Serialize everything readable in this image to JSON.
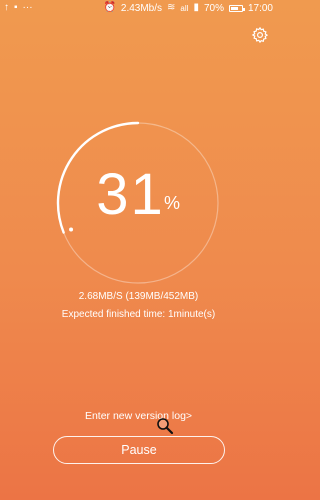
{
  "status_bar": {
    "speed": "2.43Mb/s",
    "signal": "all",
    "battery": "70%",
    "battery_level": 0.7,
    "time": "17:00",
    "left_icons": [
      "upload-icon",
      "image-icon",
      "more-dots-icon"
    ],
    "right_icons": [
      "alarm-icon",
      "wifi-icon",
      "signal-icon",
      "battery-icon"
    ]
  },
  "settings": {
    "icon": "gear-icon"
  },
  "progress": {
    "value": 31,
    "percent_text": "31",
    "percent_sign": "%"
  },
  "download": {
    "speed_line": "2.68MB/S (139MB/452MB)",
    "eta_line": "Expected finished time: 1minute(s)"
  },
  "version_log_link": "Enter new version log>",
  "pause_button": "Pause",
  "colors": {
    "bg_top": "#f09a4f",
    "bg_bottom": "#ec7445",
    "foreground": "#ffffff"
  }
}
